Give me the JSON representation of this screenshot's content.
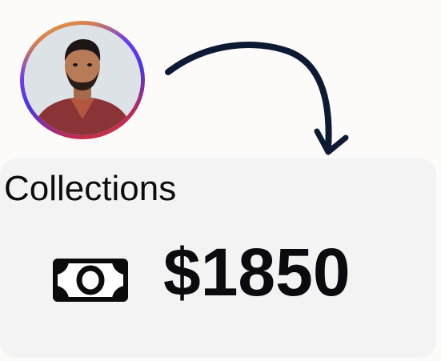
{
  "profile": {
    "avatar_icon": "user-avatar-photo"
  },
  "decoration": {
    "arrow_icon": "curved-arrow-down-icon"
  },
  "collections_card": {
    "title": "Collections",
    "amount": "$1850",
    "money_icon": "cash-icon"
  },
  "colors": {
    "page_background": "#fdfbfa",
    "card_background": "#f4f3f4",
    "text": "#0a0a0f",
    "avatar_ring": [
      "#f6b62b",
      "#4b34e6",
      "#e23325"
    ]
  }
}
